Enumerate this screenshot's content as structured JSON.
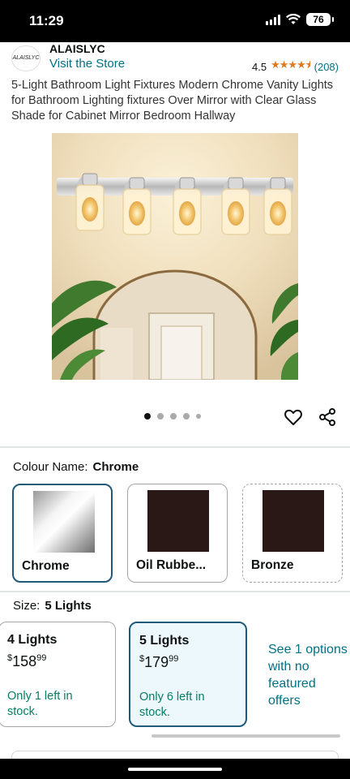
{
  "status_bar": {
    "time": "11:29",
    "battery": "76"
  },
  "brand": {
    "logo_text": "ALAISLYC",
    "name": "ALAISLYC",
    "visit_store": "Visit the Store"
  },
  "rating": {
    "value": "4.5",
    "stars": "★★★★⯨",
    "count": "(208)",
    "stars_fraction": 0.9
  },
  "product": {
    "title": "5-Light Bathroom Light Fixtures Modern Chrome Vanity Lights for Bathroom Lighting fixtures Over Mirror with Clear Glass Shade for Cabinet Mirror Bedroom Hallway",
    "image_count": 5,
    "active_image": 1
  },
  "colour": {
    "label": "Colour Name:",
    "selected": "Chrome",
    "options": [
      {
        "label": "Chrome",
        "swatch": "chrome-gradient",
        "selected": true
      },
      {
        "label": "Oil Rubbe...",
        "swatch": "#2a1816",
        "selected": false
      },
      {
        "label": "Bronze",
        "swatch": "#2a1816",
        "selected": false
      }
    ]
  },
  "size": {
    "label": "Size:",
    "selected": "5 Lights",
    "options": [
      {
        "name": "4 Lights",
        "currency": "$",
        "price_whole": "158",
        "price_fraction": "99",
        "stock": "Only 1 left in stock.",
        "selected": false
      },
      {
        "name": "5 Lights",
        "currency": "$",
        "price_whole": "179",
        "price_fraction": "99",
        "stock": "Only 6 left in stock.",
        "selected": true
      }
    ],
    "more_options": "See 1 options with no featured offers"
  },
  "colors": {
    "link": "#007185",
    "stock_green": "#067d62",
    "selected_border": "#1f5a7a",
    "star": "#de7921"
  }
}
